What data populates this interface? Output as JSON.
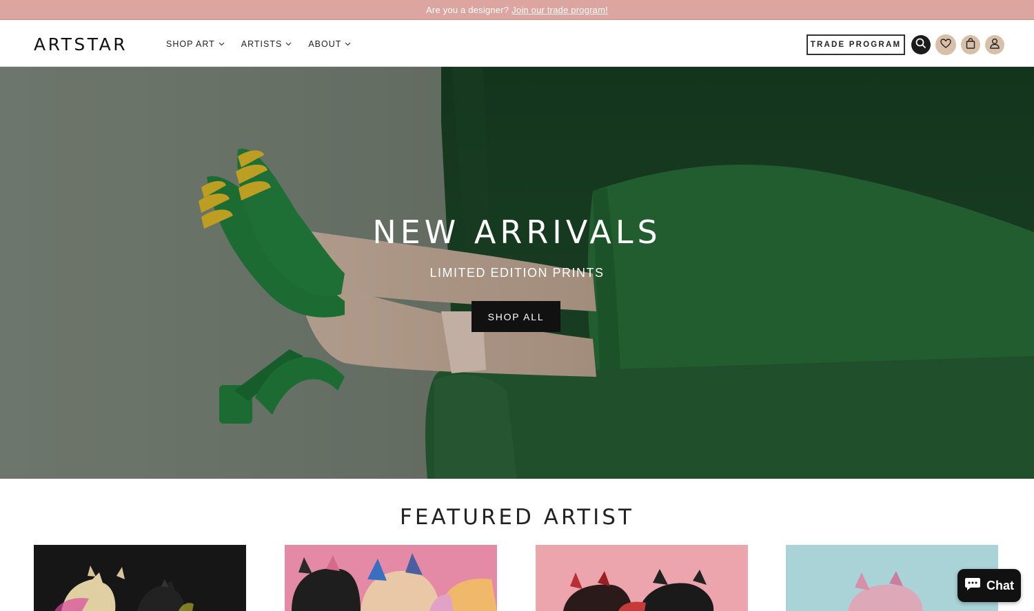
{
  "announcement": {
    "text": "Are you a designer?",
    "link": "Join our trade program!"
  },
  "header": {
    "logo": "ARTSTAR",
    "nav": [
      {
        "label": "SHOP ART"
      },
      {
        "label": "ARTISTS"
      },
      {
        "label": "ABOUT"
      }
    ],
    "trade_button": "TRADE PROGRAM",
    "icons": [
      "search-icon",
      "heart-icon",
      "bag-icon",
      "user-icon"
    ]
  },
  "hero": {
    "title": "NEW ARRIVALS",
    "subtitle": "LIMITED EDITION PRINTS",
    "button": "SHOP ALL"
  },
  "featured": {
    "title": "FEATURED ARTIST"
  },
  "chat": {
    "label": "Chat"
  },
  "colors": {
    "announcement_bg": "#dda59f",
    "icon_accent": "#d8bfa8",
    "hero_green": "#245a32"
  }
}
